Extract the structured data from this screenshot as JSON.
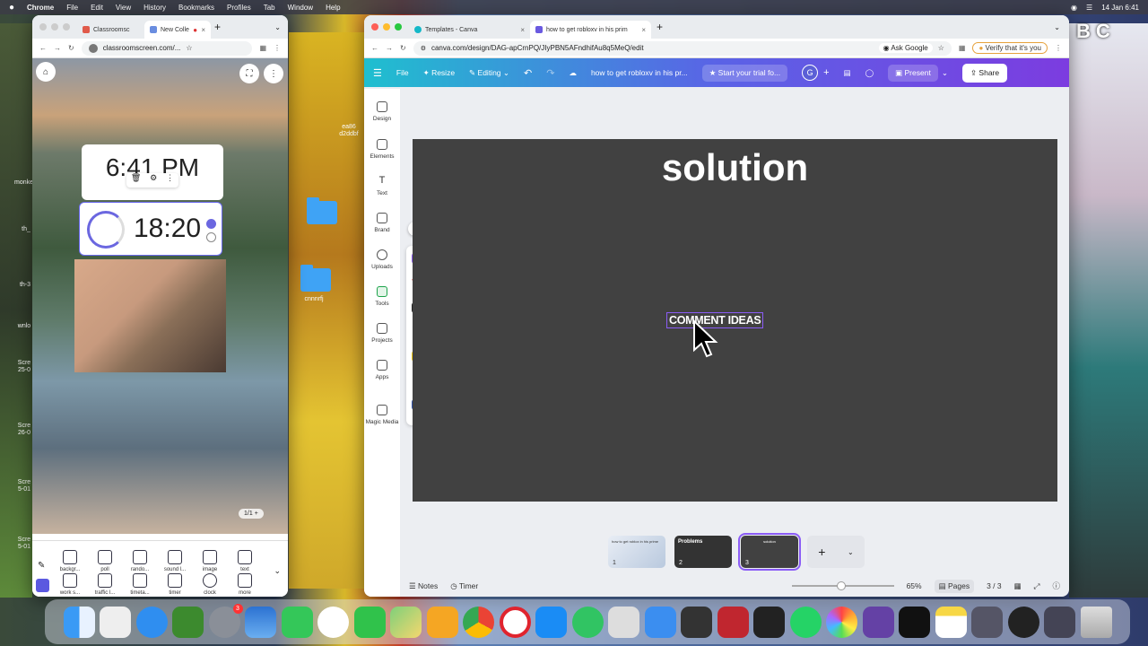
{
  "menubar": {
    "app": "Chrome",
    "items": [
      "File",
      "Edit",
      "View",
      "History",
      "Bookmarks",
      "Profiles",
      "Tab",
      "Window",
      "Help"
    ],
    "datetime": "14 Jan  6:41"
  },
  "desktop": {
    "files": [
      "ea86 d2ddbf",
      "th_",
      "monkey",
      "th-3",
      "wnlo",
      "Scre 25-0",
      "Scre 26-0",
      "Scre 5-01",
      "Scre 5-01",
      "cnnnrfj"
    ],
    "corner_text": "BC"
  },
  "left_window": {
    "tabs": [
      {
        "label": "Classroomsc"
      },
      {
        "label": "New Colle"
      }
    ],
    "url": "classroomscreen.com/...",
    "clock": "6:41 PM",
    "timer": "18:20",
    "page_counter": "1/1",
    "tools": [
      {
        "label": "backgr..."
      },
      {
        "label": "poll"
      },
      {
        "label": "rando..."
      },
      {
        "label": "sound l..."
      },
      {
        "label": "image"
      },
      {
        "label": "text"
      },
      {
        "label": "work s..."
      },
      {
        "label": "traffic l..."
      },
      {
        "label": "timeta..."
      },
      {
        "label": "timer"
      },
      {
        "label": "clock"
      },
      {
        "label": "more"
      }
    ]
  },
  "right_window": {
    "tabs": [
      {
        "label": "Templates - Canva"
      },
      {
        "label": "how to get robloxv in his prim"
      }
    ],
    "url": "canva.com/design/DAG-apCrnPQ/JIyPBN5AFndhifAu8q5MeQ/edit",
    "ask_google": "Ask Google",
    "verify": "Verify that it's you",
    "toolbar": {
      "file": "File",
      "resize": "Resize",
      "editing": "Editing",
      "doc_title": "how to get robloxv in his pr...",
      "trial": "Start your trial fo...",
      "avatar": "G",
      "present": "Present",
      "share": "Share"
    },
    "sidebar": [
      "Design",
      "Elements",
      "Text",
      "Brand",
      "Uploads",
      "Tools",
      "Projects",
      "Apps",
      "Magic Media"
    ],
    "slide": {
      "title": "solution",
      "body": "COMMENT IDEAS"
    },
    "thumbnails": [
      {
        "num": "1",
        "caption": "how to get roblox in his prime"
      },
      {
        "num": "2",
        "caption": "Problems"
      },
      {
        "num": "3",
        "caption": "solution"
      }
    ],
    "bottom": {
      "notes": "Notes",
      "timer": "Timer",
      "zoom": "65%",
      "pages": "Pages",
      "page_count": "3 / 3"
    }
  },
  "dock": {
    "badge": "3"
  }
}
